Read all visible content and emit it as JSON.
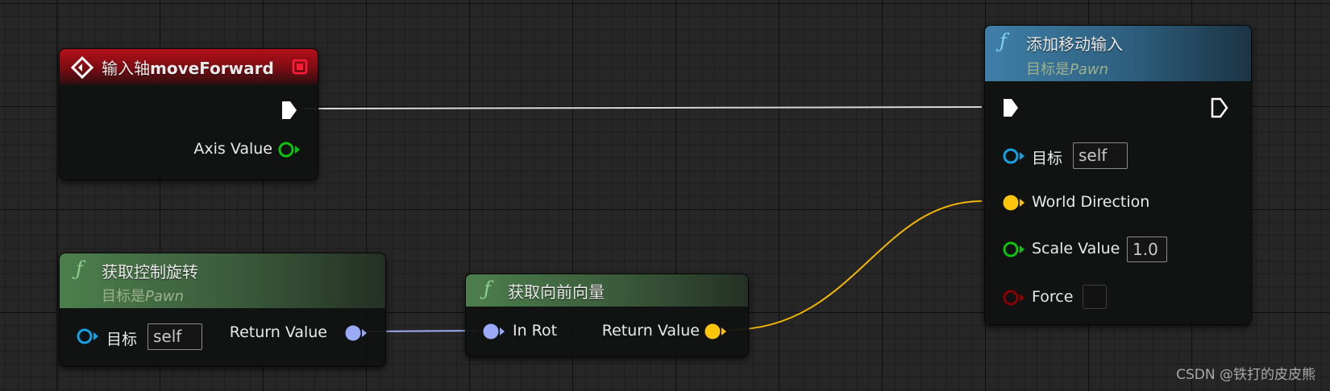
{
  "nodes": {
    "input_axis": {
      "title_prefix": "输入轴",
      "title_name": "moveForward",
      "pins": {
        "axis_value": "Axis Value"
      }
    },
    "get_control_rotation": {
      "title": "获取控制旋转",
      "subtitle_prefix": "目标是",
      "subtitle_class": "Pawn",
      "pins": {
        "target": "目标",
        "target_value": "self",
        "return_value": "Return Value"
      }
    },
    "get_forward_vector": {
      "title": "获取向前向量",
      "pins": {
        "in_rot": "In Rot",
        "return_value": "Return Value"
      }
    },
    "add_movement_input": {
      "title": "添加移动输入",
      "subtitle_prefix": "目标是",
      "subtitle_class": "Pawn",
      "pins": {
        "target": "目标",
        "target_value": "self",
        "world_direction": "World Direction",
        "scale_value": "Scale Value",
        "scale_value_value": "1.0",
        "force": "Force",
        "force_checked": false
      }
    }
  },
  "icons": {
    "function_glyph": "ƒ",
    "event_icon": "event-diamond-icon",
    "delegate_icon": "red-square-icon"
  },
  "pin_colors": {
    "exec": "#ffffff",
    "float": "#0ec20e",
    "object": "#16a1e2",
    "vector": "#fbc609",
    "rotator": "#9aaaf6",
    "bool": "#8a0202"
  },
  "watermark": "CSDN @铁打的皮皮熊"
}
